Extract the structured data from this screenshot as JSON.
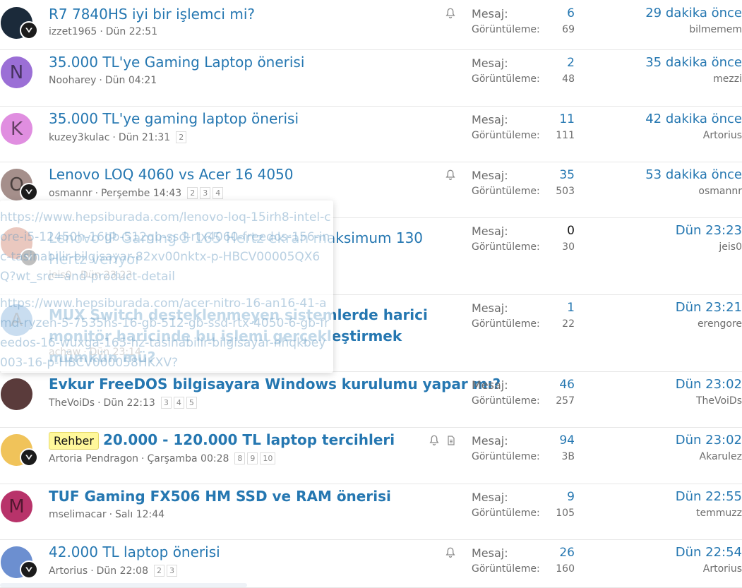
{
  "threads": [
    {
      "title": "R7 7840HS iyi bir işlemci mi?",
      "author": "izzet1965",
      "date": "Dün 22:51",
      "pages": [],
      "replies_label": "Mesaj:",
      "replies": "6",
      "views_label": "Görüntüleme:",
      "views": "69",
      "last_time": "29 dakika önce",
      "last_user": "bilmemem",
      "bell": true,
      "avatar_letter": "",
      "avatar_color": "#1b2a3a",
      "bold": false,
      "prefix": ""
    },
    {
      "title": "35.000 TL'ye Gaming Laptop önerisi",
      "author": "Nooharey",
      "date": "Dün 04:21",
      "pages": [],
      "replies_label": "Mesaj:",
      "replies": "2",
      "views_label": "Görüntüleme:",
      "views": "48",
      "last_time": "35 dakika önce",
      "last_user": "mezzi",
      "bell": false,
      "avatar_letter": "N",
      "avatar_color": "#9b6fd6",
      "bold": false,
      "prefix": ""
    },
    {
      "title": "35.000 TL'ye gaming laptop önerisi",
      "author": "kuzey3kulac",
      "date": "Dün 21:31",
      "pages": [
        "2"
      ],
      "replies_label": "Mesaj:",
      "replies": "11",
      "views_label": "Görüntüleme:",
      "views": "111",
      "last_time": "42 dakika önce",
      "last_user": "Artorius",
      "bell": false,
      "avatar_letter": "K",
      "avatar_color": "#e08ee0",
      "bold": false,
      "prefix": ""
    },
    {
      "title": "Lenovo LOQ 4060 vs Acer 16 4050",
      "author": "osmannr",
      "date": "Perşembe 14:43",
      "pages": [
        "2",
        "3",
        "4"
      ],
      "replies_label": "Mesaj:",
      "replies": "35",
      "views_label": "Görüntüleme:",
      "views": "503",
      "last_time": "53 dakika önce",
      "last_user": "osmannr",
      "bell": true,
      "avatar_letter": "O",
      "avatar_color": "#a58f8b",
      "bold": false,
      "prefix": ""
    },
    {
      "title": "Lenovo IP Gaming 3 165 Hertz ekran maksimum 130 Hertz veriyor",
      "author": "jeis0",
      "date": "Dün 23:23",
      "pages": [],
      "replies_label": "Mesaj:",
      "replies": "0",
      "views_label": "Görüntüleme:",
      "views": "30",
      "last_time": "Dün 23:23",
      "last_user": "jeis0",
      "bell": false,
      "avatar_letter": "",
      "avatar_color": "#b33a1a",
      "bold": false,
      "prefix": ""
    },
    {
      "title": "MUX Switch desteklenmeyen sistemlerde harici monitör haricinde bu işlemi gerçekleştirmek mümkün mü?",
      "author": "achaw",
      "date": "Dün 23:14",
      "pages": [],
      "replies_label": "Mesaj:",
      "replies": "1",
      "views_label": "Görüntüleme:",
      "views": "22",
      "last_time": "Dün 23:21",
      "last_user": "erengore",
      "bell": false,
      "avatar_letter": "A",
      "avatar_color": "#3f86c8",
      "bold": true,
      "prefix": ""
    },
    {
      "title": "Evkur FreeDOS bilgisayara Windows kurulumu yapar mı?",
      "author": "TheVoiDs",
      "date": "Dün 22:13",
      "pages": [
        "3",
        "4",
        "5"
      ],
      "replies_label": "Mesaj:",
      "replies": "46",
      "views_label": "Görüntüleme:",
      "views": "257",
      "last_time": "Dün 23:02",
      "last_user": "TheVoiDs",
      "bell": false,
      "avatar_letter": "",
      "avatar_color": "#5a3b3b",
      "bold": true,
      "prefix": ""
    },
    {
      "title": "20.000 - 120.000 TL laptop tercihleri",
      "author": "Artoria Pendragon",
      "date": "Çarşamba 00:28",
      "pages": [
        "8",
        "9",
        "10"
      ],
      "replies_label": "Mesaj:",
      "replies": "94",
      "views_label": "Görüntüleme:",
      "views": "3B",
      "last_time": "Dün 23:02",
      "last_user": "Akarulez",
      "bell": true,
      "avatar_letter": "",
      "avatar_color": "#f0c35a",
      "bold": true,
      "prefix": "Rehber"
    },
    {
      "title": "TUF Gaming FX506 HM SSD ve RAM önerisi",
      "author": "mselimacar",
      "date": "Salı 12:44",
      "pages": [],
      "replies_label": "Mesaj:",
      "replies": "9",
      "views_label": "Görüntüleme:",
      "views": "105",
      "last_time": "Dün 22:55",
      "last_user": "temmuzz",
      "bell": false,
      "avatar_letter": "M",
      "avatar_color": "#b8336a",
      "bold": true,
      "prefix": ""
    },
    {
      "title": "42.000 TL laptop önerisi",
      "author": "Artorius",
      "date": "Dün 22:08",
      "pages": [
        "2",
        "3"
      ],
      "replies_label": "Mesaj:",
      "replies": "26",
      "views_label": "Görüntüleme:",
      "views": "160",
      "last_time": "Dün 22:54",
      "last_user": "Artorius",
      "bell": true,
      "avatar_letter": "",
      "avatar_color": "#6c8fd0",
      "bold": false,
      "prefix": ""
    }
  ],
  "tooltip": {
    "line1": "https://www.hepsiburada.com/lenovo-loq-15irh8-intel-core-i5-12450h-16gb-512gb-ssd-rtx4060-freedos-156-inc-tasinabilir-bilgisayar-82xv00nktx-p-HBCV00005QX6Q?wt_src=and-product-detail",
    "line2": "https://www.hepsiburada.com/acer-nitro-16-an16-41-amd-ryzen-5-7535hs-16-gb-512-gb-ssd-rtx-4050-6-gb-freedos-16-wuxga-165-hz-tasinabilir-bilgisayar-nhqkbey003-16-p-HBCV000058HKXV?"
  }
}
